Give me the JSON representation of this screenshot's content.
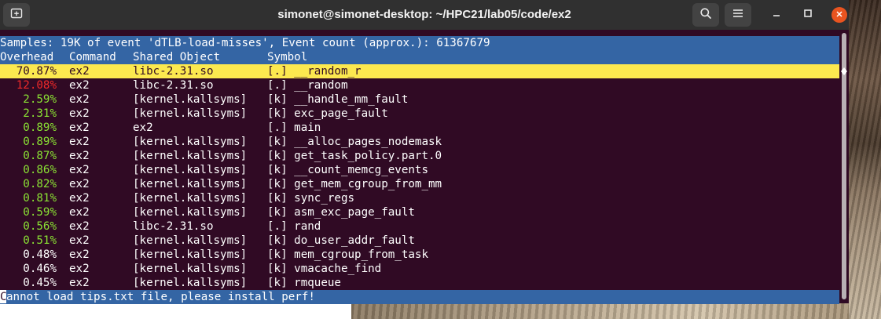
{
  "window": {
    "title": "simonet@simonet-desktop: ~/HPC21/lab05/code/ex2"
  },
  "titlebar": {
    "new_tab_icon": "new-tab-icon",
    "search_icon": "search-icon",
    "menu_icon": "hamburger-menu-icon",
    "minimize_icon": "minimize-icon",
    "maximize_icon": "maximize-icon",
    "close_icon": "close-icon",
    "close_color": "#e95420"
  },
  "colors": {
    "terminal_bg": "#300a24",
    "header_bg": "#3465a4",
    "selection_bg": "#fce94f",
    "overhead_high": "#ef2929",
    "overhead_mid": "#8ae234"
  },
  "perf": {
    "header": "Samples: 19K of event 'dTLB-load-misses', Event count (approx.): 61367679",
    "columns": {
      "overhead": "Overhead",
      "command": "Command",
      "shared_object": "Shared Object",
      "symbol": "Symbol"
    },
    "rows": [
      {
        "overhead": "70.87%",
        "command": "ex2",
        "shared_object": "libc-2.31.so",
        "symbol": "[.] __random_r"
      },
      {
        "overhead": "12.08%",
        "command": "ex2",
        "shared_object": "libc-2.31.so",
        "symbol": "[.] __random"
      },
      {
        "overhead": "2.59%",
        "command": "ex2",
        "shared_object": "[kernel.kallsyms]",
        "symbol": "[k] __handle_mm_fault"
      },
      {
        "overhead": "2.31%",
        "command": "ex2",
        "shared_object": "[kernel.kallsyms]",
        "symbol": "[k] exc_page_fault"
      },
      {
        "overhead": "0.89%",
        "command": "ex2",
        "shared_object": "ex2",
        "symbol": "[.] main"
      },
      {
        "overhead": "0.89%",
        "command": "ex2",
        "shared_object": "[kernel.kallsyms]",
        "symbol": "[k] __alloc_pages_nodemask"
      },
      {
        "overhead": "0.87%",
        "command": "ex2",
        "shared_object": "[kernel.kallsyms]",
        "symbol": "[k] get_task_policy.part.0"
      },
      {
        "overhead": "0.86%",
        "command": "ex2",
        "shared_object": "[kernel.kallsyms]",
        "symbol": "[k] __count_memcg_events"
      },
      {
        "overhead": "0.82%",
        "command": "ex2",
        "shared_object": "[kernel.kallsyms]",
        "symbol": "[k] get_mem_cgroup_from_mm"
      },
      {
        "overhead": "0.81%",
        "command": "ex2",
        "shared_object": "[kernel.kallsyms]",
        "symbol": "[k] sync_regs"
      },
      {
        "overhead": "0.59%",
        "command": "ex2",
        "shared_object": "[kernel.kallsyms]",
        "symbol": "[k] asm_exc_page_fault"
      },
      {
        "overhead": "0.56%",
        "command": "ex2",
        "shared_object": "libc-2.31.so",
        "symbol": "[.] rand"
      },
      {
        "overhead": "0.51%",
        "command": "ex2",
        "shared_object": "[kernel.kallsyms]",
        "symbol": "[k] do_user_addr_fault"
      },
      {
        "overhead": "0.48%",
        "command": "ex2",
        "shared_object": "[kernel.kallsyms]",
        "symbol": "[k] mem_cgroup_from_task"
      },
      {
        "overhead": "0.46%",
        "command": "ex2",
        "shared_object": "[kernel.kallsyms]",
        "symbol": "[k] vmacache_find"
      },
      {
        "overhead": "0.45%",
        "command": "ex2",
        "shared_object": "[kernel.kallsyms]",
        "symbol": "[k] rmqueue"
      }
    ],
    "selected_row": 0,
    "status_first_char": "C",
    "status_rest": "annot load tips.txt file, please install perf!"
  }
}
